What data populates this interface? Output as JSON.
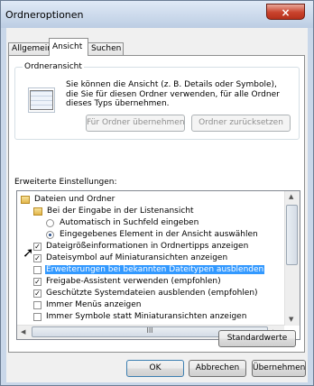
{
  "window": {
    "title": "Ordneroptionen",
    "close_label": "×"
  },
  "tabs": [
    {
      "label": "Allgemein",
      "active": false
    },
    {
      "label": "Ansicht",
      "active": true
    },
    {
      "label": "Suchen",
      "active": false
    }
  ],
  "folder_view": {
    "legend": "Ordneransicht",
    "description": "Sie können die Ansicht (z. B. Details oder Symbole), die Sie für diesen Ordner verwenden, für alle Ordner dieses Typs übernehmen.",
    "apply_button": "Für Ordner übernehmen",
    "reset_button": "Ordner zurücksetzen"
  },
  "advanced": {
    "label": "Erweiterte Einstellungen:",
    "items": [
      {
        "kind": "folder",
        "label": "Dateien und Ordner"
      },
      {
        "kind": "folder",
        "label": "Bei der Eingabe in der Listenansicht"
      },
      {
        "kind": "radio",
        "checked": false,
        "label": "Automatisch in Suchfeld eingeben"
      },
      {
        "kind": "radio",
        "checked": true,
        "label": "Eingegebenes Element in der Ansicht auswählen"
      },
      {
        "kind": "checkbox",
        "checked": true,
        "label": "Dateigrößeinformationen in Ordnertipps anzeigen"
      },
      {
        "kind": "checkbox",
        "checked": true,
        "label": "Dateisymbol auf Miniaturansichten anzeigen"
      },
      {
        "kind": "checkbox",
        "checked": false,
        "label": "Erweiterungen bei bekannten Dateitypen ausblenden"
      },
      {
        "kind": "checkbox",
        "checked": true,
        "label": "Freigabe-Assistent verwenden (empfohlen)"
      },
      {
        "kind": "checkbox",
        "checked": true,
        "label": "Geschützte Systemdateien ausblenden (empfohlen)"
      },
      {
        "kind": "checkbox",
        "checked": false,
        "label": "Immer Menüs anzeigen"
      },
      {
        "kind": "checkbox",
        "checked": false,
        "label": "Immer Symbole statt Miniaturansichten anzeigen"
      }
    ],
    "scroll_grip": "III",
    "defaults_button": "Standardwerte"
  },
  "footer": {
    "ok": "OK",
    "cancel": "Abbrechen",
    "apply": "Übernehmen"
  },
  "check_mark": "✓"
}
